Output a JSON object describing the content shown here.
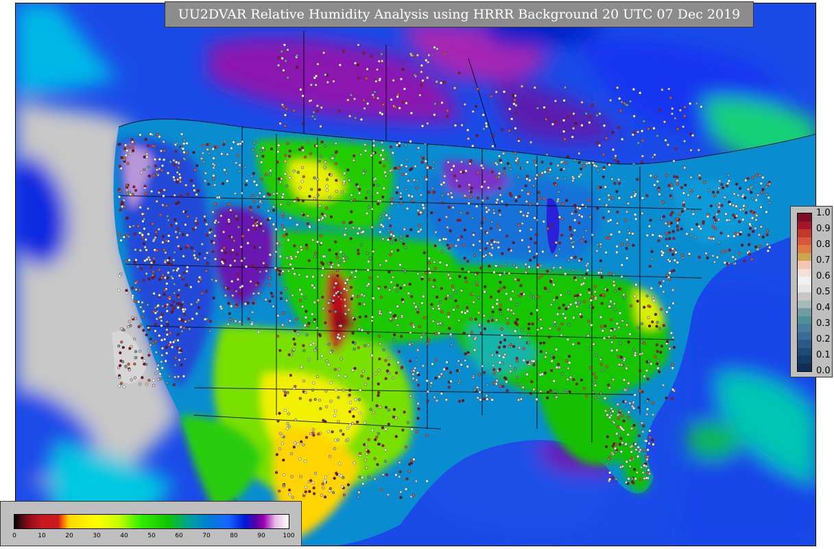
{
  "title": "UU2DVAR Relative Humidity Analysis using HRRR Background 20 UTC 07 Dec 2019",
  "quality_legend": {
    "ticks": [
      "1.0",
      "0.9",
      "0.8",
      "0.7",
      "0.6",
      "0.5",
      "0.4",
      "0.3",
      "0.2",
      "0.1",
      "0.0"
    ],
    "colors": [
      "#7a0f25",
      "#a3172b",
      "#c2392c",
      "#d6573a",
      "#e07a45",
      "#c8a84f",
      "#f2c8b4",
      "#f6dfd4",
      "#f2f2f2",
      "#e6e6e6",
      "#c7c7c7",
      "#a6bcbc",
      "#6e9e9e",
      "#4f8f9a",
      "#467d9c",
      "#3b6c95",
      "#2b5a86",
      "#1f4a76",
      "#163a66",
      "#0f2d55"
    ]
  },
  "rh_legend": {
    "ticks": [
      "0",
      "10",
      "20",
      "30",
      "40",
      "50",
      "60",
      "70",
      "80",
      "90",
      "100"
    ]
  },
  "map_colors": {
    "ocean_dry": "#c8c8c8",
    "ocean_blue": "#1a4be8",
    "ocean_cyan": "#00b0d8",
    "purple": "#7a10a8",
    "green": "#17c400",
    "yellow": "#ffff00",
    "red": "#b00e1e",
    "teal": "#1ab4a8",
    "lines": "#000000"
  }
}
